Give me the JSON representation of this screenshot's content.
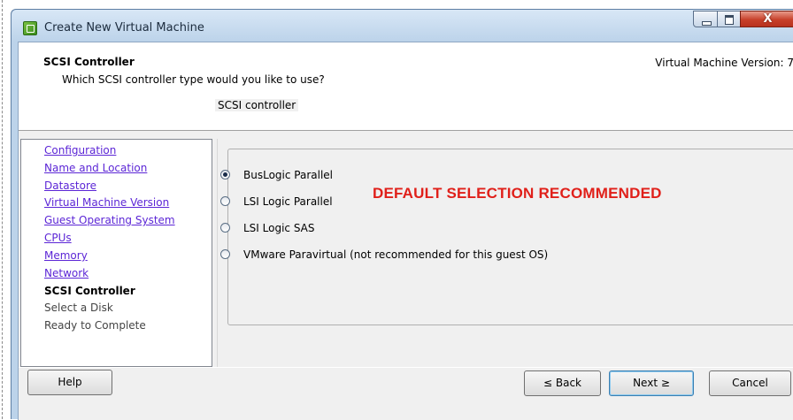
{
  "window": {
    "title": "Create New Virtual Machine",
    "close_glyph": "X"
  },
  "header": {
    "title": "SCSI Controller",
    "description": "Which SCSI controller type would you like to use?",
    "version": "Virtual Machine Version: 7"
  },
  "steps": [
    {
      "label": "Configuration",
      "state": "link"
    },
    {
      "label": "Name and Location",
      "state": "link"
    },
    {
      "label": "Datastore",
      "state": "link"
    },
    {
      "label": "Virtual Machine Version",
      "state": "link"
    },
    {
      "label": "Guest Operating System",
      "state": "link"
    },
    {
      "label": "CPUs",
      "state": "link"
    },
    {
      "label": "Memory",
      "state": "link"
    },
    {
      "label": "Network",
      "state": "link"
    },
    {
      "label": "SCSI Controller",
      "state": "current"
    },
    {
      "label": "Select a Disk",
      "state": "disabled"
    },
    {
      "label": "Ready to Complete",
      "state": "disabled"
    }
  ],
  "scsi_group": {
    "label": "SCSI controller",
    "options": [
      {
        "label": "BusLogic Parallel",
        "checked": true
      },
      {
        "label": "LSI Logic Parallel",
        "checked": false
      },
      {
        "label": "LSI Logic SAS",
        "checked": false
      },
      {
        "label": "VMware Paravirtual (not recommended for this guest OS)",
        "checked": false
      }
    ],
    "annotation": "DEFAULT SELECTION RECOMMENDED"
  },
  "footer": {
    "help": "Help",
    "back": "≤ Back",
    "next": "Next ≥",
    "cancel": "Cancel"
  },
  "colors": {
    "annotation": "#e0201a",
    "link": "#5c26d6",
    "title_bar": "#bcd3ea",
    "close_button": "#c7402a"
  },
  "icons": [
    "vm-app-icon",
    "minimize-icon",
    "maximize-icon",
    "close-icon",
    "radio-icon"
  ]
}
